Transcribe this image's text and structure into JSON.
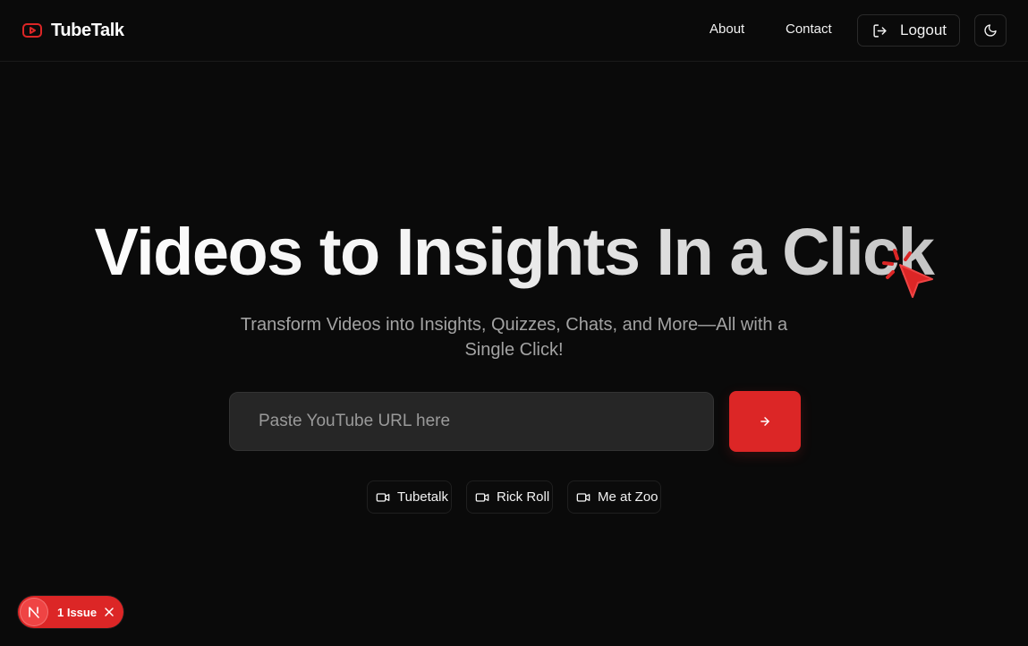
{
  "navbar": {
    "brand_name": "TubeTalk",
    "links": [
      "About",
      "Contact"
    ],
    "logout_label": "Logout",
    "theme_toggle_icon": "moon-icon"
  },
  "hero": {
    "title": "Videos to Insights In a Click",
    "subtitle": "Transform Videos into Insights, Quizzes, Chats, and More—All with a Single Click!"
  },
  "search": {
    "placeholder": "Paste YouTube URL here",
    "value": "",
    "submit_icon": "arrow-right-icon"
  },
  "sample_videos": [
    {
      "label": "Tubetalk",
      "icon": "video-icon"
    },
    {
      "label": "Rick Roll",
      "icon": "video-icon"
    },
    {
      "label": "Me at Zoo",
      "icon": "video-icon"
    }
  ],
  "dev_overlay": {
    "issues_label": "1 Issue",
    "logo_letter": "N"
  },
  "colors": {
    "background": "#0a0a0a",
    "accent": "#dc2626",
    "muted_text": "#a3a3a3",
    "input_bg": "#262626"
  }
}
